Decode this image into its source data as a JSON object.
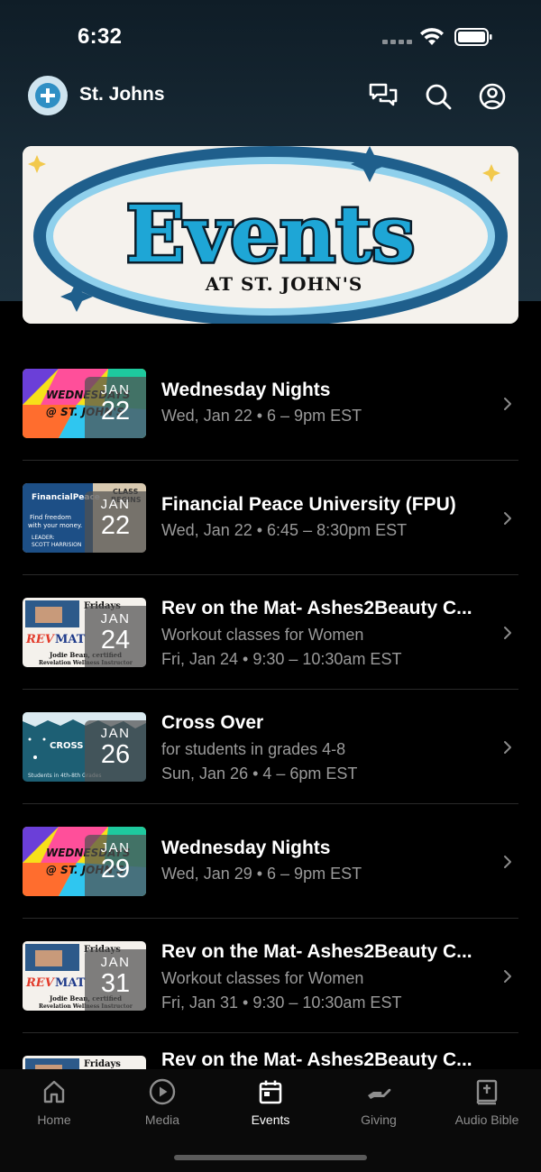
{
  "status_bar": {
    "time": "6:32"
  },
  "header": {
    "app_name": "St. Johns"
  },
  "banner": {
    "line1": "Events",
    "line2": "AT ST. JOHN'S"
  },
  "events": [
    {
      "title": "Wednesday Nights",
      "subtitle": "",
      "when": "Wed, Jan 22 • 6 – 9pm EST",
      "month": "JAN",
      "day": "22",
      "thumb": "wed"
    },
    {
      "title": "Financial Peace University (FPU)",
      "subtitle": "",
      "when": "Wed, Jan 22 • 6:45 – 8:30pm EST",
      "month": "JAN",
      "day": "22",
      "thumb": "fpu"
    },
    {
      "title": "Rev on the Mat- Ashes2Beauty C...",
      "subtitle": "Workout classes for Women",
      "when": "Fri, Jan 24 • 9:30 – 10:30am EST",
      "month": "JAN",
      "day": "24",
      "thumb": "rev"
    },
    {
      "title": "Cross Over",
      "subtitle": "for students in grades 4-8",
      "when": "Sun, Jan 26 • 4 – 6pm EST",
      "month": "JAN",
      "day": "26",
      "thumb": "cross"
    },
    {
      "title": "Wednesday Nights",
      "subtitle": "",
      "when": "Wed, Jan 29 • 6 – 9pm EST",
      "month": "JAN",
      "day": "29",
      "thumb": "wed"
    },
    {
      "title": "Rev on the Mat- Ashes2Beauty C...",
      "subtitle": "Workout classes for Women",
      "when": "Fri, Jan 31 • 9:30 – 10:30am EST",
      "month": "JAN",
      "day": "31",
      "thumb": "rev"
    },
    {
      "title": "Rev on the Mat- Ashes2Beauty C...",
      "subtitle": "",
      "when": "",
      "month": "",
      "day": "",
      "thumb": "rev"
    }
  ],
  "tabs": [
    {
      "label": "Home",
      "icon": "home-icon",
      "active": false
    },
    {
      "label": "Media",
      "icon": "play-circle-icon",
      "active": false
    },
    {
      "label": "Events",
      "icon": "calendar-icon",
      "active": true
    },
    {
      "label": "Giving",
      "icon": "giving-hand-icon",
      "active": false
    },
    {
      "label": "Audio Bible",
      "icon": "bible-icon",
      "active": false
    }
  ],
  "colors": {
    "background": "#000000",
    "header_bg": "#172833",
    "muted_text": "#9a9a9a",
    "active_tab": "#ffffff",
    "inactive_tab": "#8e8e8e"
  }
}
